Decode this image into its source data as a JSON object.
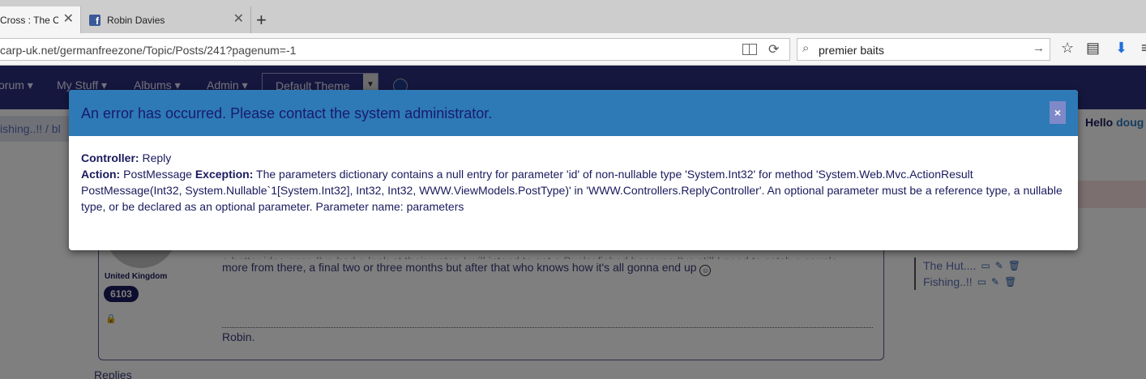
{
  "browser": {
    "tabs": [
      {
        "title": "Cross : The Of",
        "active": true
      },
      {
        "title": "Robin Davies",
        "active": false,
        "icon": "facebook-icon"
      }
    ],
    "url": "carp-uk.net/germanfreezone/Topic/Posts/241?pagenum=-1",
    "search_value": "premier baits"
  },
  "site": {
    "nav": [
      "orum ▾",
      "My Stuff ▾",
      "Albums ▾",
      "Admin ▾"
    ],
    "theme": "Default Theme",
    "breadcrumb": "ishing..!! /   bl",
    "hello_prefix": "Hello ",
    "hello_user": "doug",
    "post": {
      "line1": "a better idea once I've had a look at their water. I will intend to get a Bucky fished because I've still I need to catch a couple",
      "line2": "more from there, a final two or three months but after that who knows how it's all gonna end up",
      "signature": "Robin."
    },
    "author": {
      "country": "United Kingdom",
      "post_count": "6103"
    },
    "replies": "Replies",
    "side_items": [
      "The Hut....",
      "Fishing..!!"
    ]
  },
  "modal": {
    "title": "An error has occurred. Please contact the system administrator.",
    "close_label": "×",
    "controller_label": "Controller:",
    "controller_value": "Reply",
    "action_label": "Action:",
    "action_value": "PostMessage",
    "exception_label": "Exception:",
    "exception_value": "The parameters dictionary contains a null entry for parameter 'id' of non-nullable type 'System.Int32' for method 'System.Web.Mvc.ActionResult PostMessage(Int32, System.Nullable`1[System.Int32], Int32, Int32, WWW.ViewModels.PostType)' in 'WWW.Controllers.ReplyController'. An optional parameter must be a reference type, a nullable type, or be declared as an optional parameter. Parameter name: parameters"
  },
  "colors": {
    "nav_bg": "#2c2f7c",
    "modal_header": "#2d7ab7",
    "modal_text": "#1a1a5e"
  }
}
